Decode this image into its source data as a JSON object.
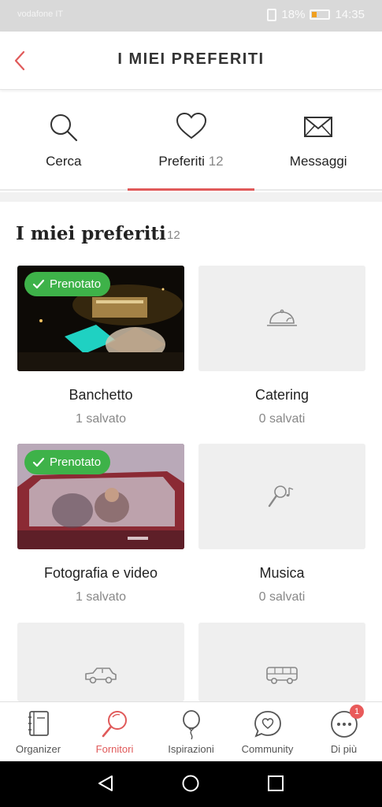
{
  "status_bar": {
    "carrier": "vodafone IT",
    "battery": "18%",
    "time": "14:35"
  },
  "header": {
    "title": "I MIEI PREFERITI",
    "back_icon": "chevron-left-icon"
  },
  "tabs": [
    {
      "label": "Cerca",
      "count": "",
      "icon": "search-icon",
      "active": false
    },
    {
      "label": "Preferiti",
      "count": "12",
      "icon": "heart-icon",
      "active": true
    },
    {
      "label": "Messaggi",
      "count": "",
      "icon": "envelope-icon",
      "active": false
    }
  ],
  "section": {
    "title": "I miei preferiti",
    "count": "12"
  },
  "cards": [
    {
      "name": "Banchetto",
      "saved": "1 salvato",
      "badge": "Prenotato",
      "has_photo": true
    },
    {
      "name": "Catering",
      "saved": "0 salvati",
      "icon": "cloche-icon"
    },
    {
      "name": "Fotografia e video",
      "saved": "1 salvato",
      "badge": "Prenotato",
      "has_photo": true
    },
    {
      "name": "Musica",
      "saved": "0 salvati",
      "icon": "microphone-icon"
    },
    {
      "name": "",
      "saved": "",
      "icon": "car-icon"
    },
    {
      "name": "",
      "saved": "",
      "icon": "bus-icon"
    }
  ],
  "bottom_nav": [
    {
      "label": "Organizer",
      "icon": "notebook-icon",
      "active": false
    },
    {
      "label": "Fornitori",
      "icon": "magnifier-icon",
      "active": true
    },
    {
      "label": "Ispirazioni",
      "icon": "balloon-icon",
      "active": false
    },
    {
      "label": "Community",
      "icon": "chat-heart-icon",
      "active": false
    },
    {
      "label": "Di più",
      "icon": "more-dots-icon",
      "active": false,
      "badge": "1"
    }
  ],
  "colors": {
    "accent": "#e05a5a",
    "booked_badge": "#3eb249",
    "placeholder_bg": "#efefef"
  }
}
